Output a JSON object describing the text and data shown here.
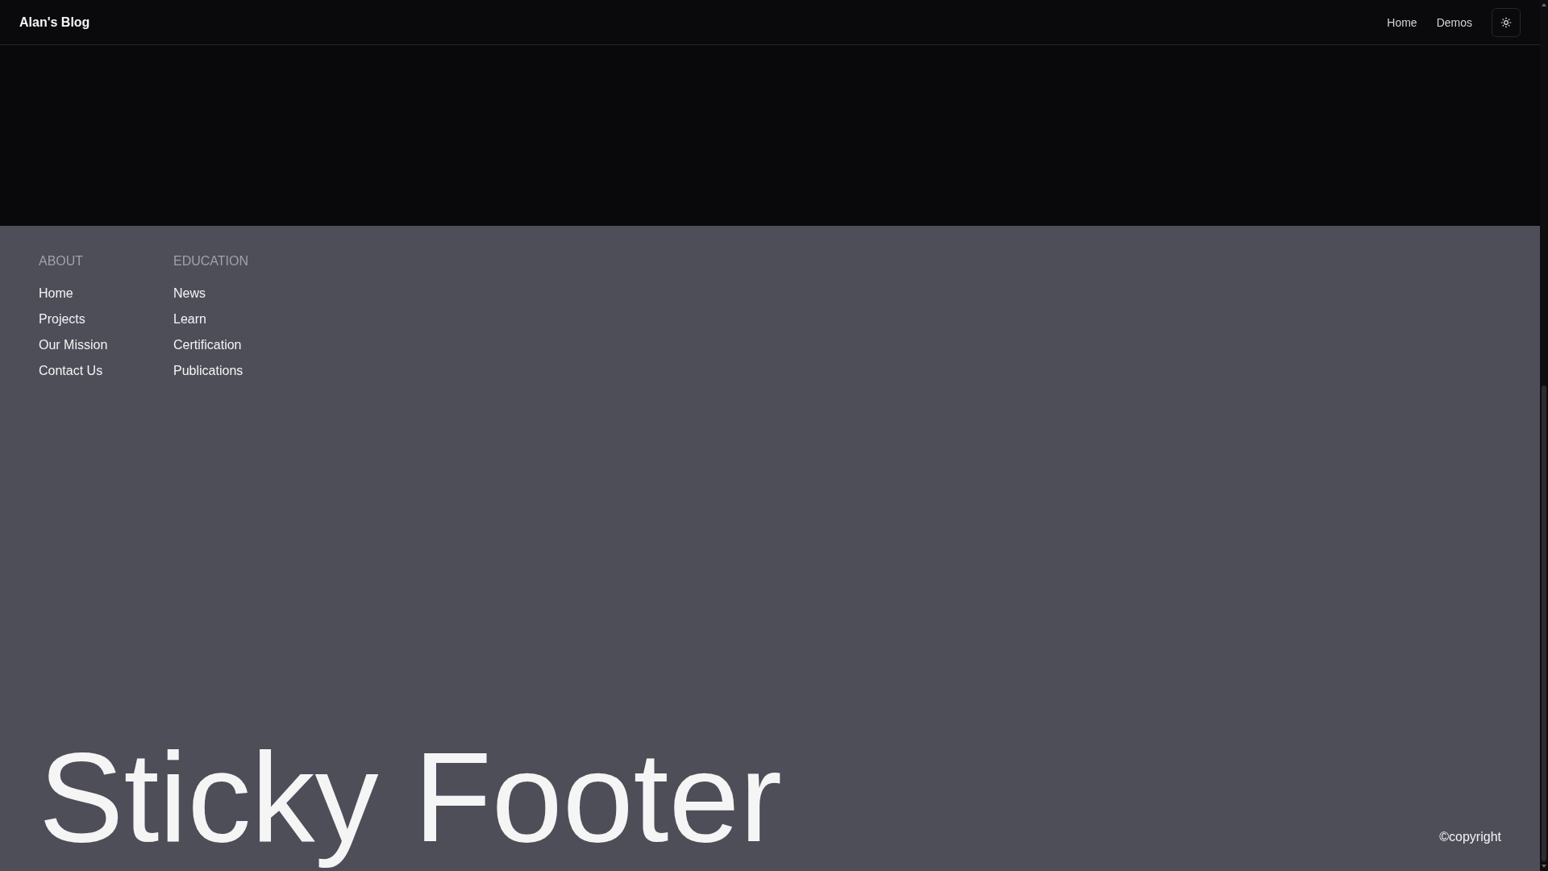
{
  "header": {
    "title": "Alan's Blog",
    "nav": [
      "Home",
      "Demos"
    ]
  },
  "footer": {
    "columns": [
      {
        "heading": "ABOUT",
        "links": [
          "Home",
          "Projects",
          "Our Mission",
          "Contact Us"
        ]
      },
      {
        "heading": "EDUCATION",
        "links": [
          "News",
          "Learn",
          "Certification",
          "Publications"
        ]
      }
    ],
    "headline": "Sticky Footer",
    "copyright": "©copyright"
  }
}
